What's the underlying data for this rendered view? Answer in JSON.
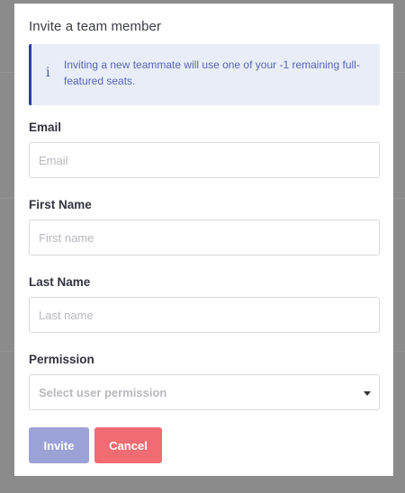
{
  "modal": {
    "title": "Invite a team member",
    "notice": {
      "icon": "info-icon",
      "icon_glyph": "i",
      "text": "Inviting a new teammate will use one of your -1 remaining full-featured seats."
    },
    "fields": {
      "email": {
        "label": "Email",
        "placeholder": "Email",
        "value": ""
      },
      "first_name": {
        "label": "First Name",
        "placeholder": "First name",
        "value": ""
      },
      "last_name": {
        "label": "Last Name",
        "placeholder": "Last name",
        "value": ""
      },
      "permission": {
        "label": "Permission",
        "placeholder": "Select user permission",
        "icon": "caret-down-icon"
      }
    },
    "buttons": {
      "invite": "Invite",
      "cancel": "Cancel"
    },
    "colors": {
      "notice_bg": "#e9edf8",
      "notice_accent": "#2e3d8f",
      "invite_button": "#9aa2d6",
      "cancel_button": "#f06b72",
      "overlay": "#8a8a8a"
    }
  }
}
